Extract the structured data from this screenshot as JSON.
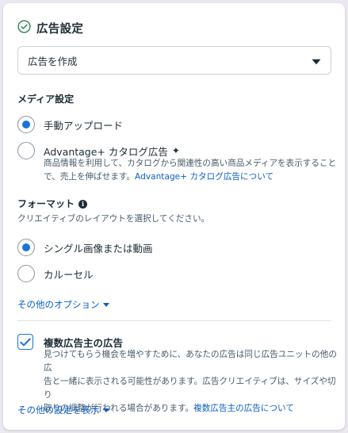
{
  "header": {
    "title": "広告設定"
  },
  "ad_select": {
    "value": "広告を作成"
  },
  "media": {
    "heading": "メディア設定",
    "manual_label": "手動アップロード",
    "advantage_label": "Advantage+ カタログ広告",
    "advantage_desc_1": "商品情報を利用して、カタログから関連性の高い商品メディアを表示すること",
    "advantage_desc_2": "で、売上を伸ばせます。",
    "advantage_link": "Advantage+ カタログ広告について"
  },
  "format": {
    "heading": "フォーマット",
    "desc": "クリエイティブのレイアウトを選択してください。",
    "single_label": "シングル画像または動画",
    "carousel_label": "カルーセル",
    "more_options": "その他のオプション"
  },
  "multi_advertiser": {
    "label": "複数広告主の広告",
    "checked": true,
    "desc_1": "見つけてもらう機会を増やすために、あなたの広告は同じ広告ユニットの他の広",
    "desc_2": "告と一緒に表示される可能性があります。広告クリエイティブは、サイズや切り",
    "desc_3": "取りの調整が行われる場合があります。",
    "link": "複数広告主の広告について"
  },
  "footer": {
    "more_settings": "その他の設定を表示"
  },
  "colors": {
    "accent": "#1a73d9",
    "link": "#0a5fc2",
    "text": "#1c2b33"
  },
  "icons": {
    "title": "check-circle-icon",
    "dropdown": "caret-down-icon",
    "sparkle": "sparkle-icon",
    "info": "info-icon",
    "checkbox": "checkmark-icon"
  }
}
